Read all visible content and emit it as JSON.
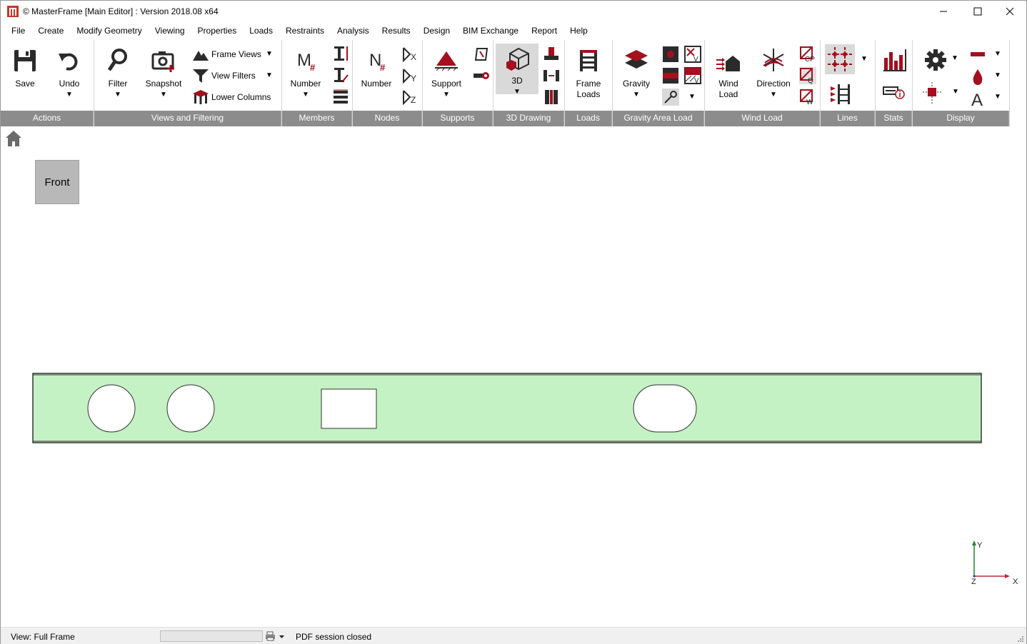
{
  "window": {
    "title": "© MasterFrame [Main Editor] : Version 2018.08 x64"
  },
  "menu": [
    "File",
    "Create",
    "Modify Geometry",
    "Viewing",
    "Properties",
    "Loads",
    "Restraints",
    "Analysis",
    "Results",
    "Design",
    "BIM Exchange",
    "Report",
    "Help"
  ],
  "ribbon": {
    "groups": {
      "actions": "Actions",
      "views": "Views and Filtering",
      "members": "Members",
      "nodes": "Nodes",
      "supports": "Supports",
      "drawing": "3D Drawing",
      "loads": "Loads",
      "gravity": "Gravity Area Load",
      "wind": "Wind Load",
      "lines": "Lines",
      "stats": "Stats",
      "display": "Display"
    },
    "buttons": {
      "save": "Save",
      "undo": "Undo",
      "filter": "Filter",
      "snapshot": "Snapshot",
      "frame_views": "Frame Views",
      "view_filters": "View Filters",
      "lower_columns": "Lower Columns",
      "member_number": "Number",
      "node_number": "Number",
      "support": "Support",
      "drawing_3d": "3D",
      "frame_loads_1": "Frame",
      "frame_loads_2": "Loads",
      "gravity": "Gravity",
      "wind_load_1": "Wind",
      "wind_load_2": "Load",
      "direction": "Direction"
    },
    "icon_letters": {
      "member_m": "M",
      "node_n": "N",
      "hash": "#",
      "kx": "X",
      "ky": "Y",
      "kz": "Z",
      "cp": "CP",
      "q": "Q",
      "w": "W",
      "v": "V",
      "text_a": "A"
    }
  },
  "canvas": {
    "front_label": "Front",
    "axis": {
      "y": "Y",
      "x": "X",
      "z": "Z"
    },
    "colors": {
      "panel_fill": "#c5f2c5",
      "accent": "#a50f1e"
    }
  },
  "status": {
    "view": "View: Full Frame",
    "pdf": "PDF session closed"
  }
}
